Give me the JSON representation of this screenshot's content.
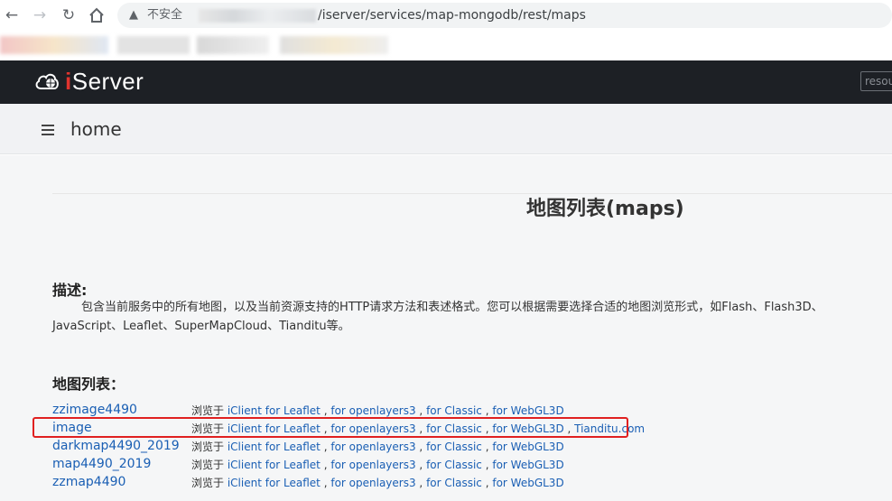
{
  "browser": {
    "insecure_label": "不安全",
    "url_path": "/iserver/services/map-mongodb/rest/maps"
  },
  "header": {
    "logo_text_i": "i",
    "logo_text_rest": "Server",
    "search_placeholder": "resou"
  },
  "breadcrumb": {
    "home_label": "home"
  },
  "page": {
    "title": "地图列表(maps)",
    "description_heading": "描述:",
    "description_text": "包含当前服务中的所有地图，以及当前资源支持的HTTP请求方法和表述格式。您可以根据需要选择合适的地图浏览形式，如Flash、Flash3D、JavaScript、Leaflet、SuperMapCloud、Tianditu等。",
    "list_heading": "地图列表："
  },
  "maps": [
    {
      "name": "zzimage4490",
      "prefix": "浏览于 ",
      "links": [
        "iClient for Leaflet",
        "for openlayers3",
        "for Classic",
        "for WebGL3D"
      ]
    },
    {
      "name": "image",
      "prefix": "浏览于 ",
      "links": [
        "iClient for Leaflet",
        "for openlayers3",
        "for Classic",
        "for WebGL3D",
        "Tianditu.com"
      ]
    },
    {
      "name": "darkmap4490_2019",
      "prefix": "浏览于 ",
      "links": [
        "iClient for Leaflet",
        "for openlayers3",
        "for Classic",
        "for WebGL3D"
      ]
    },
    {
      "name": "map4490_2019",
      "prefix": "浏览于 ",
      "links": [
        "iClient for Leaflet",
        "for openlayers3",
        "for Classic",
        "for WebGL3D"
      ]
    },
    {
      "name": "zzmap4490",
      "prefix": "浏览于 ",
      "links": [
        "iClient for Leaflet",
        "for openlayers3",
        "for Classic",
        "for WebGL3D"
      ]
    }
  ],
  "colors": {
    "header_bg": "#1d2025",
    "link": "#1a5fb4",
    "highlight_border": "#e02020",
    "logo_accent": "#e0332e"
  },
  "icons": {
    "back": "back-arrow-icon",
    "forward": "forward-arrow-icon",
    "reload": "reload-icon",
    "home": "home-icon",
    "warning": "warning-icon",
    "logo": "cloud-globe-logo-icon",
    "menu": "list-icon"
  }
}
